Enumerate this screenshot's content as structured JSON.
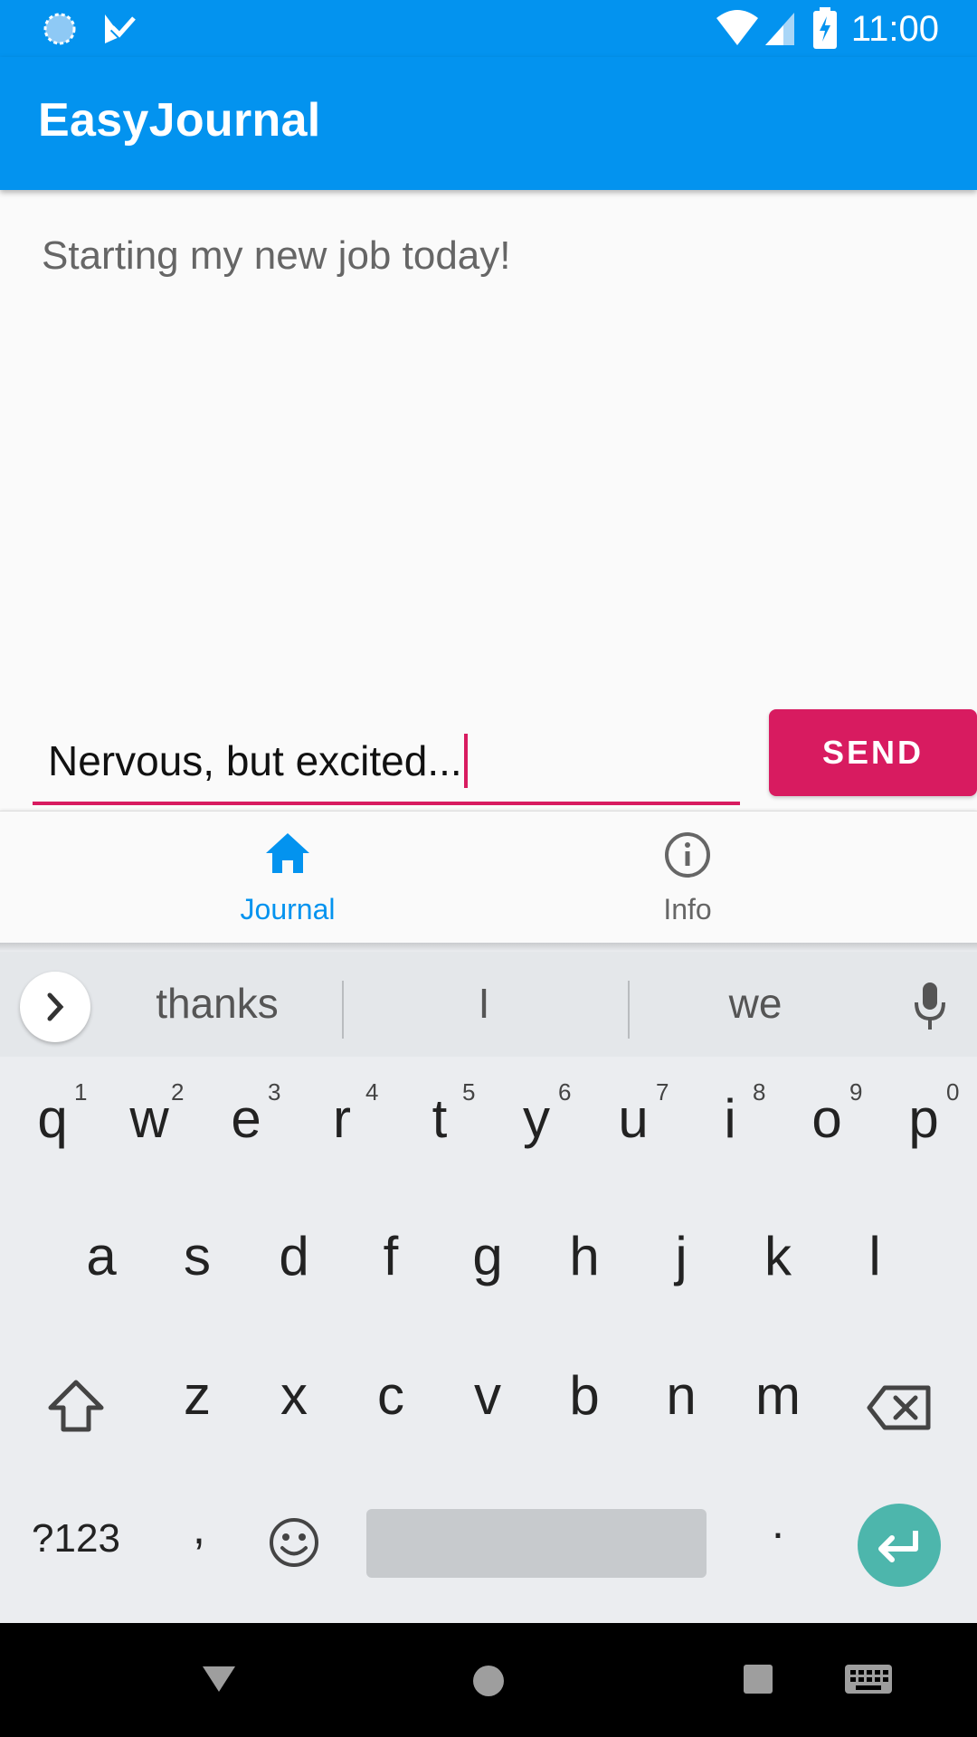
{
  "status_bar": {
    "time": "11:00",
    "icons": [
      "sync-icon",
      "check-icon",
      "wifi-icon",
      "signal-icon",
      "battery-charging-icon"
    ]
  },
  "app": {
    "title": "EasyJournal"
  },
  "journal": {
    "entries": [
      "Starting my new job today!"
    ],
    "input_value": "Nervous, but excited...",
    "send_label": "SEND"
  },
  "bottom_nav": {
    "items": [
      {
        "label": "Journal",
        "icon": "home-icon",
        "active": true
      },
      {
        "label": "Info",
        "icon": "info-icon",
        "active": false
      }
    ],
    "active_color": "#0393ef",
    "inactive_color": "#666666"
  },
  "keyboard": {
    "suggestions": [
      "thanks",
      "I",
      "we"
    ],
    "row1": [
      "q",
      "w",
      "e",
      "r",
      "t",
      "y",
      "u",
      "i",
      "o",
      "p"
    ],
    "row1_hints": [
      "1",
      "2",
      "3",
      "4",
      "5",
      "6",
      "7",
      "8",
      "9",
      "0"
    ],
    "row2": [
      "a",
      "s",
      "d",
      "f",
      "g",
      "h",
      "j",
      "k",
      "l"
    ],
    "row3": [
      "z",
      "x",
      "c",
      "v",
      "b",
      "n",
      "m"
    ],
    "symbols_label": "?123",
    "comma": ",",
    "period": "."
  },
  "colors": {
    "primary": "#0393ef",
    "accent": "#d81b60",
    "enter_key": "#4db6ac"
  }
}
